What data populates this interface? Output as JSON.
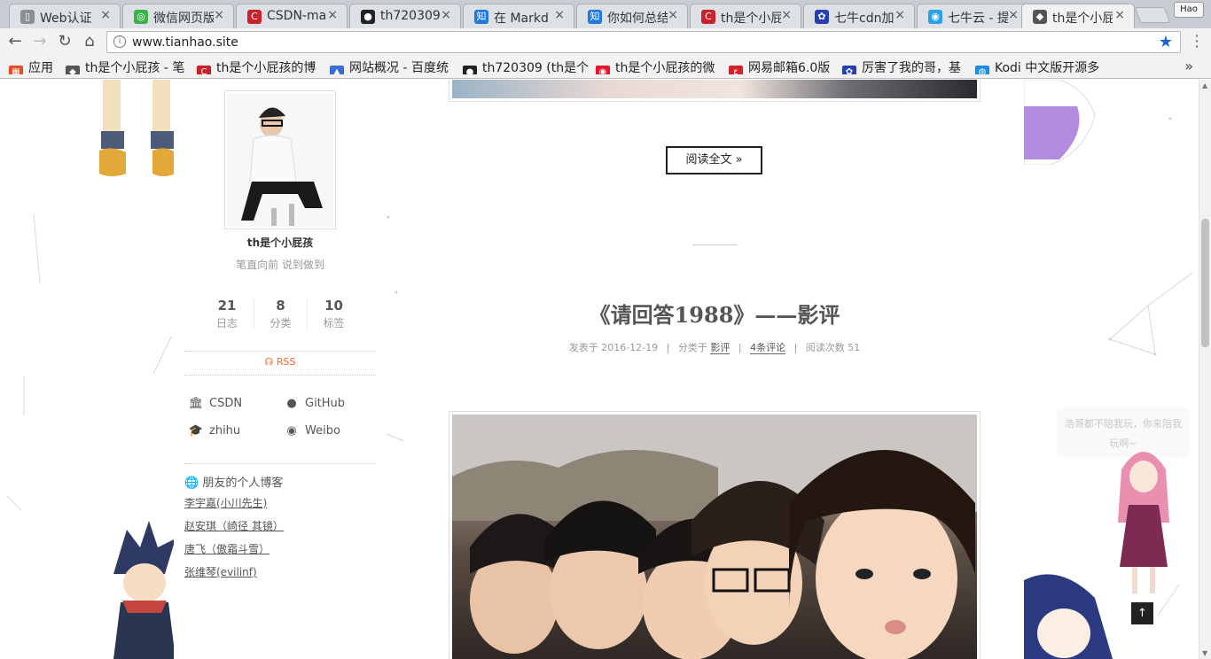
{
  "browser": {
    "tabs": [
      {
        "title": "Web认证",
        "fav_color": "#8a8f95",
        "fav_glyph": "▯"
      },
      {
        "title": "微信网页版",
        "fav_color": "#3bb34a",
        "fav_glyph": "◎"
      },
      {
        "title": "CSDN-ma",
        "fav_color": "#c9202b",
        "fav_glyph": "C"
      },
      {
        "title": "th720309",
        "fav_color": "#222222",
        "fav_glyph": "●"
      },
      {
        "title": "在 Markd",
        "fav_color": "#1f7ae0",
        "fav_glyph": "知"
      },
      {
        "title": "你如何总结",
        "fav_color": "#1f7ae0",
        "fav_glyph": "知"
      },
      {
        "title": "th是个小屁",
        "fav_color": "#c9202b",
        "fav_glyph": "C"
      },
      {
        "title": "七牛cdn加",
        "fav_color": "#2440b3",
        "fav_glyph": "✿"
      },
      {
        "title": "七牛云 - 提",
        "fav_color": "#2aa0e8",
        "fav_glyph": "◉"
      },
      {
        "title": "th是个小屁",
        "fav_color": "#555555",
        "fav_glyph": "◆"
      }
    ],
    "tab_close": "×",
    "profile_label": "Hao",
    "url": "www.tianhao.site",
    "bookmarks": [
      {
        "label": "应用",
        "icon_color": "#e44d26",
        "glyph": "▦"
      },
      {
        "label": "th是个小屁孩 - 笔",
        "icon_color": "#555555",
        "glyph": "◆"
      },
      {
        "label": "th是个小屁孩的博",
        "icon_color": "#c9202b",
        "glyph": "C"
      },
      {
        "label": "网站概况 - 百度统",
        "icon_color": "#3c6bd8",
        "glyph": "▲"
      },
      {
        "label": "th720309 (th是个",
        "icon_color": "#222222",
        "glyph": "●"
      },
      {
        "label": "th是个小屁孩的微",
        "icon_color": "#e6162d",
        "glyph": "◉"
      },
      {
        "label": "网易邮箱6.0版",
        "icon_color": "#d5212c",
        "glyph": "ε"
      },
      {
        "label": "厉害了我的哥，基",
        "icon_color": "#2440b3",
        "glyph": "✿"
      },
      {
        "label": "Kodi 中文版开源多",
        "icon_color": "#1f8ee0",
        "glyph": "◍"
      }
    ],
    "bookmarks_more": "»"
  },
  "sidebar": {
    "author": "th是个小屁孩",
    "motto": "笔直向前 说到做到",
    "stats": [
      {
        "num": "21",
        "label": "日志"
      },
      {
        "num": "8",
        "label": "分类"
      },
      {
        "num": "10",
        "label": "标签"
      }
    ],
    "rss": "RSS",
    "social": [
      {
        "label": "CSDN",
        "icon": "bank-icon"
      },
      {
        "label": "GitHub",
        "icon": "github-icon"
      },
      {
        "label": "zhihu",
        "icon": "graduation-cap-icon"
      },
      {
        "label": "Weibo",
        "icon": "weibo-icon"
      }
    ],
    "links_title": "朋友的个人博客",
    "links": [
      "李宇嘉(小川先生)",
      "赵安琪（崎径 其镜）",
      "唐飞（傲霜斗雪）",
      "张维琴(evilinf)"
    ]
  },
  "main": {
    "read_more": "阅读全文 »",
    "post_title": "《请回答1988》——影评",
    "meta": {
      "posted_prefix": "发表于",
      "date": "2016-12-19",
      "category_prefix": "分类于",
      "category": "影评",
      "comments": "4条评论",
      "views_prefix": "阅读次数",
      "views": "51"
    }
  },
  "widgets": {
    "speech": "浩哥都不陪我玩，你来陪我玩啊~",
    "back_to_top": "↑"
  }
}
